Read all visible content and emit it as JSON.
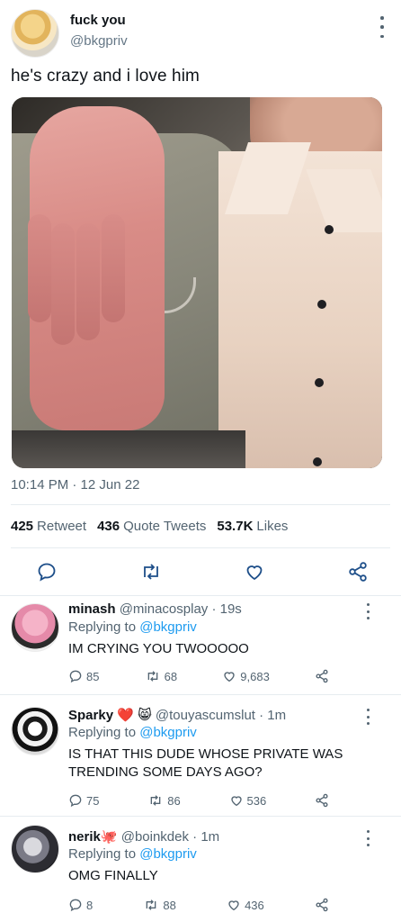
{
  "post": {
    "display_name": "fuck you",
    "handle": "@bkgpriv",
    "text": "he's crazy and i love him",
    "timestamp": "10:14 PM · 12 Jun 22",
    "stats": {
      "retweets_count": "425",
      "retweets_label": "Retweet",
      "quotes_count": "436",
      "quotes_label": "Quote Tweets",
      "likes_count": "53.7K",
      "likes_label": "Likes"
    },
    "icons": [
      "reply-icon",
      "retweet-icon",
      "like-icon",
      "share-icon",
      "more-icon"
    ]
  },
  "replies": [
    {
      "name": "minash",
      "handle_time": "@minacosplay · 19s",
      "replying_prefix": "Replying to",
      "replying_to": "@bkgpriv",
      "text": "IM CRYING YOU TWOOOOO",
      "reply_count": "85",
      "retweet_count": "68",
      "like_count": "9,683"
    },
    {
      "name": "Sparky",
      "emojis": "❤️ 😸",
      "handle_time": "@touyascumslut · 1m",
      "replying_prefix": "Replying to",
      "replying_to": "@bkgpriv",
      "text": "IS THAT THIS DUDE WHOSE PRIVATE WAS TRENDING SOME DAYS AGO?",
      "reply_count": "75",
      "retweet_count": "86",
      "like_count": "536"
    },
    {
      "name": "nerik",
      "emojis": "🐙",
      "handle_time": "@boinkdek · 1m",
      "replying_prefix": "Replying to",
      "replying_to": "@bkgpriv",
      "text": "OMG FINALLY",
      "reply_count": "8",
      "retweet_count": "88",
      "like_count": "436"
    }
  ],
  "colors": {
    "text": "#0f1419",
    "secondary": "#536471",
    "link": "#1d9bf0",
    "divider": "#e6ecf0"
  }
}
